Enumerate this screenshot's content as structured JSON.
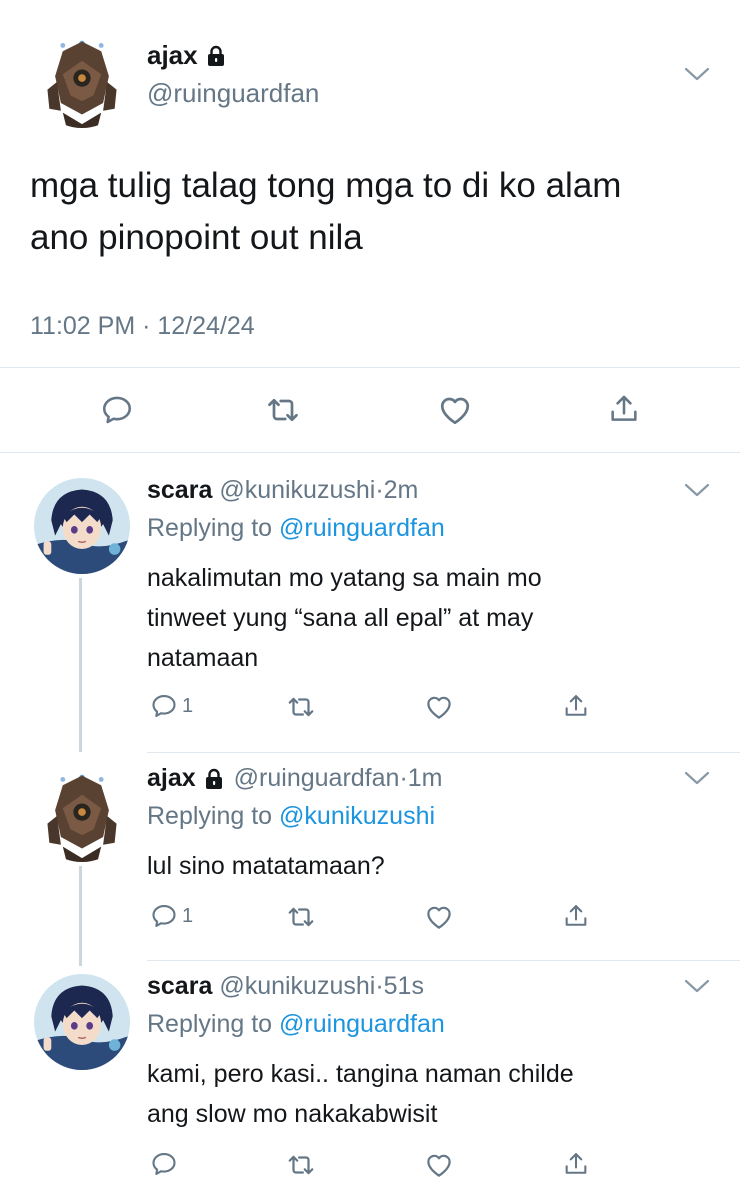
{
  "main_tweet": {
    "name": "ajax",
    "handle": "@ruinguardfan",
    "text_line1": "mga tulig talag tong mga to di ko alam",
    "text_line2": "ano pinopoint out nila",
    "time": "11:02 PM",
    "separator": "·",
    "date": "12/24/24"
  },
  "replies": [
    {
      "name": "scara",
      "handle": "@kunikuzushi",
      "dot": "·",
      "age": "2m",
      "replying_label": "Replying to",
      "replying_to": "@ruinguardfan",
      "line1": "nakalimutan mo yatang sa main mo",
      "line2": "tinweet yung “sana all epal” at may",
      "line3": "natamaan",
      "reply_count": "1"
    },
    {
      "name": "ajax",
      "handle": "@ruinguardfan",
      "dot": "·",
      "age": "1m",
      "replying_label": "Replying to",
      "replying_to": "@kunikuzushi",
      "line1": "lul sino matatamaan?",
      "reply_count": "1"
    },
    {
      "name": "scara",
      "handle": "@kunikuzushi",
      "dot": "·",
      "age": "51s",
      "replying_label": "Replying to",
      "replying_to": "@ruinguardfan",
      "line1": "kami, pero kasi.. tangina naman childe",
      "line2": "ang slow mo nakakabwisit",
      "reply_count": ""
    }
  ],
  "colors": {
    "text": "#14171a",
    "muted": "#657786",
    "link": "#1b95e0",
    "divider": "#e1e8ed"
  },
  "icons": [
    "lock-icon",
    "chevron-down-icon",
    "reply-icon",
    "retweet-icon",
    "like-icon",
    "share-icon"
  ]
}
